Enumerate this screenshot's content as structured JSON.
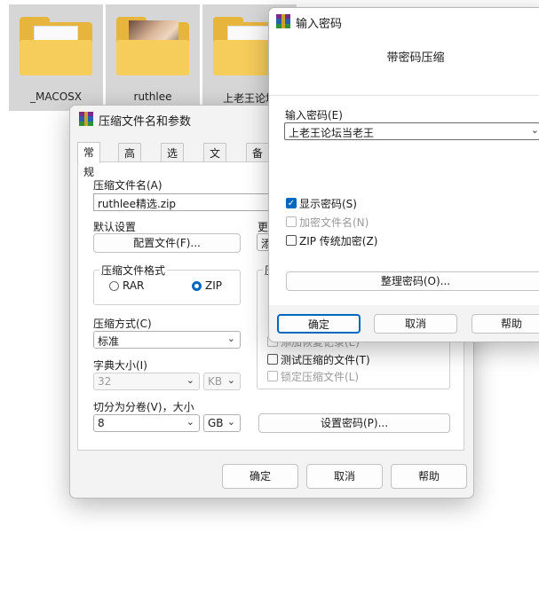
{
  "desktop": {
    "folders": [
      {
        "name": "_MACOSX"
      },
      {
        "name": "ruthlee"
      },
      {
        "name": "上老王论坛"
      }
    ]
  },
  "archive_dialog": {
    "title": "压缩文件名和参数",
    "tabs": [
      "常规",
      "高级",
      "选项",
      "文件",
      "备份"
    ],
    "archive_name_label": "压缩文件名(A)",
    "archive_name_value": "ruthlee精选.zip",
    "default_profile_label": "默认设置",
    "profile_button": "配置文件(F)...",
    "update_label": "更",
    "update_value": "添",
    "format_group_title": "压缩文件格式",
    "format_rar": "RAR",
    "format_zip": "ZIP",
    "format_selected": "ZIP",
    "method_label": "压缩方式(C)",
    "method_value": "标准",
    "dict_label": "字典大小(I)",
    "dict_value": "32",
    "dict_unit": "KB",
    "split_label": "切分为分卷(V)，大小",
    "split_value": "8",
    "split_unit": "GB",
    "options_group_title": "压",
    "opt_add_recovery": "添加恢复记录(E)",
    "opt_test": "测试压缩的文件(T)",
    "opt_lock": "锁定压缩文件(L)",
    "set_password_button": "设置密码(P)...",
    "ok_button": "确定",
    "cancel_button": "取消",
    "help_button": "帮助"
  },
  "password_dialog": {
    "title": "输入密码",
    "heading": "带密码压缩",
    "password_label": "输入密码(E)",
    "password_value": "上老王论坛当老王",
    "show_password": "显示密码(S)",
    "show_password_checked": true,
    "encrypt_names": "加密文件名(N)",
    "zip_legacy": "ZIP 传统加密(Z)",
    "organize_button": "整理密码(O)...",
    "ok_button": "确定",
    "cancel_button": "取消",
    "help_button": "帮助"
  },
  "colors": {
    "accent": "#0067c0",
    "folder_yellow": "#f6cc5a"
  }
}
